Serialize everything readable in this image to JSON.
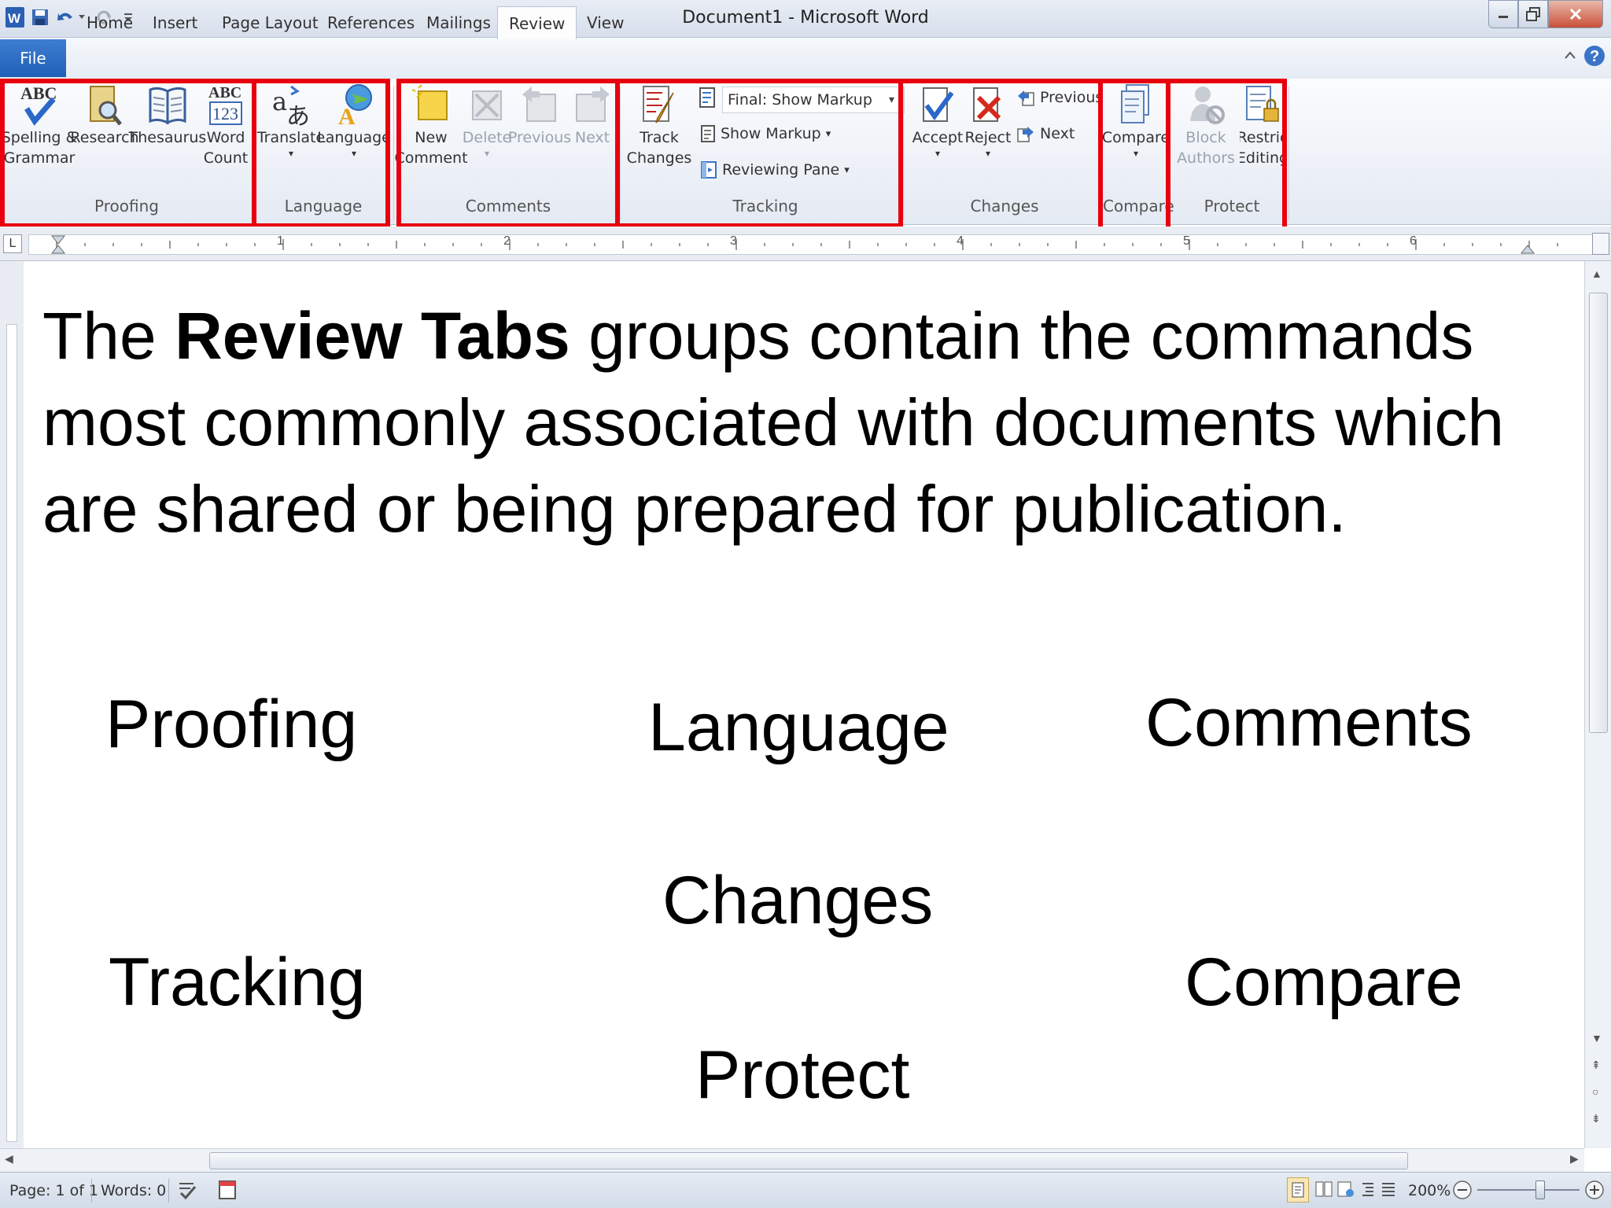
{
  "window": {
    "title": "Document1  -  Microsoft Word"
  },
  "tabs": [
    {
      "label": "File"
    },
    {
      "label": "Home"
    },
    {
      "label": "Insert"
    },
    {
      "label": "Page Layout"
    },
    {
      "label": "References"
    },
    {
      "label": "Mailings"
    },
    {
      "label": "Review"
    },
    {
      "label": "View"
    }
  ],
  "ribbon": {
    "proofing": {
      "label": "Proofing",
      "spelling": [
        "Spelling &",
        "Grammar"
      ],
      "research": "Research",
      "thesaurus": "Thesaurus",
      "word_count": [
        "Word",
        "Count"
      ]
    },
    "language": {
      "label": "Language",
      "translate": "Translate",
      "language": "Language"
    },
    "comments": {
      "label": "Comments",
      "new_comment": [
        "New",
        "Comment"
      ],
      "delete": "Delete",
      "previous": "Previous",
      "next": "Next"
    },
    "tracking": {
      "label": "Tracking",
      "track_changes": [
        "Track",
        "Changes"
      ],
      "display": "Final: Show Markup",
      "show_markup": "Show Markup",
      "reviewing_pane": "Reviewing Pane"
    },
    "changes": {
      "label": "Changes",
      "accept": "Accept",
      "reject": "Reject",
      "previous": "Previous",
      "next": "Next"
    },
    "compare": {
      "label": "Compare",
      "compare": "Compare"
    },
    "protect": {
      "label": "Protect",
      "block_authors": [
        "Block",
        "Authors"
      ],
      "restrict_editing": [
        "Restric",
        "Editing"
      ]
    }
  },
  "ruler": {
    "numbers": [
      "1",
      "2",
      "3",
      "4",
      "5",
      "6"
    ]
  },
  "document": {
    "intro_the": "The",
    "intro_bold": "Review Tabs",
    "intro_rest": "groups contain the commands most commonly associated with documents which are shared or being prepared for publication.",
    "words": {
      "proofing": "Proofing",
      "language": "Language",
      "comments": "Comments",
      "changes": "Changes",
      "tracking": "Tracking",
      "compare": "Compare",
      "protect": "Protect"
    }
  },
  "status": {
    "page": "Page: 1 of 1",
    "words": "Words: 0",
    "zoom": "200%"
  },
  "colors": {
    "highlight_box": "#e8000f",
    "file_tab": "#2a6ac4"
  }
}
